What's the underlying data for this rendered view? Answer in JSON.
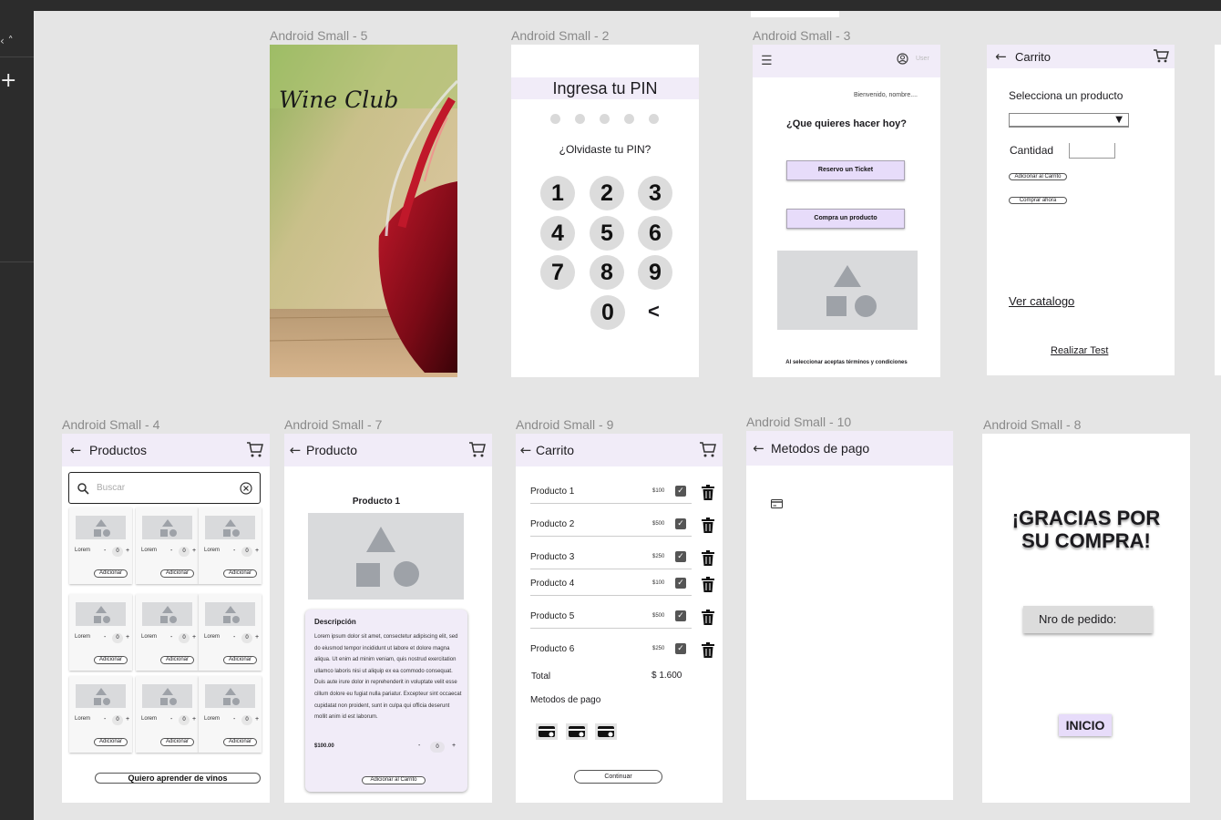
{
  "colors": {
    "canvas": "#e5e5e5",
    "appbar": "#f1ecf8",
    "accent_lavender": "#e7dcfa",
    "dark_ui": "#2c2c2c",
    "placeholder": "#d9dadc"
  },
  "frames": {
    "splash": {
      "label": "Android Small - 5",
      "brand": "Wine Club"
    },
    "pin": {
      "label": "Android Small - 2",
      "title": "Ingresa tu PIN",
      "forgot": "¿Olvidaste tu PIN?",
      "keys": [
        "1",
        "2",
        "3",
        "4",
        "5",
        "6",
        "7",
        "8",
        "9",
        "0"
      ],
      "backspace": "<"
    },
    "home": {
      "label": "Android Small - 3",
      "user": "User",
      "welcome": "Bienvenido, nombre....",
      "question": "¿Que quieres hacer hoy?",
      "btn_ticket": "Reservo un Ticket",
      "btn_buy": "Compra un producto",
      "terms": "Al seleccionar aceptas términos y condiciones"
    },
    "cart_select": {
      "label": "Carrito",
      "title": "Carrito",
      "select_label": "Selecciona un producto",
      "qty_label": "Cantidad",
      "add_btn": "Adicionar al Carrito",
      "buy_btn": "Comprar ahora",
      "catalog_link": "Ver catalogo",
      "test_link": "Realizar Test"
    },
    "products": {
      "label": "Android Small - 4",
      "title": "Productos",
      "search_placeholder": "Buscar",
      "card_lorem": "Lorem",
      "card_qty": "0",
      "card_minus": "-",
      "card_plus": "+",
      "card_btn": "Adicionar",
      "learn_btn": "Quiero aprender de vinos"
    },
    "product": {
      "label": "Android Small - 7",
      "title": "Producto",
      "name": "Producto 1",
      "desc_title": "Descripción",
      "desc": "Lorem ipsum dolor sit amet, consectetur adipiscing elit, sed do eiusmod tempor incididunt ut labore et dolore magna aliqua. Ut enim ad minim veniam, quis nostrud exercitation ullamco laboris nisi ut aliquip ex ea commodo consequat. Duis aute irure dolor in reprehenderit in voluptate velit esse cillum dolore eu fugiat nulla pariatur. Excepteur sint occaecat cupidatat non proident, sunt in culpa qui officia deserunt mollit anim id est laborum.",
      "price": "$100.00",
      "qty": "0",
      "minus": "-",
      "plus": "+",
      "add_btn": "Adicionar al Carrito"
    },
    "cart": {
      "label": "Android Small - 9",
      "title": "Carrito",
      "items": [
        {
          "name": "Producto 1",
          "price": "$100"
        },
        {
          "name": "Producto 2",
          "price": "$500"
        },
        {
          "name": "Producto 3",
          "price": "$250"
        },
        {
          "name": "Producto 4",
          "price": "$100"
        },
        {
          "name": "Producto 5",
          "price": "$500"
        },
        {
          "name": "Producto 6",
          "price": "$250"
        }
      ],
      "total_label": "Total",
      "total_value": "$ 1.600",
      "pay_label": "Metodos de pago",
      "continue_btn": "Continuar"
    },
    "payment": {
      "label": "Android Small - 10",
      "title": "Metodos de pago"
    },
    "thanks": {
      "label": "Android Small - 8",
      "line1": "¡GRACIAS POR",
      "line2": "SU COMPRA!",
      "order": "Nro de pedido:",
      "home_btn": "INICIO"
    }
  }
}
